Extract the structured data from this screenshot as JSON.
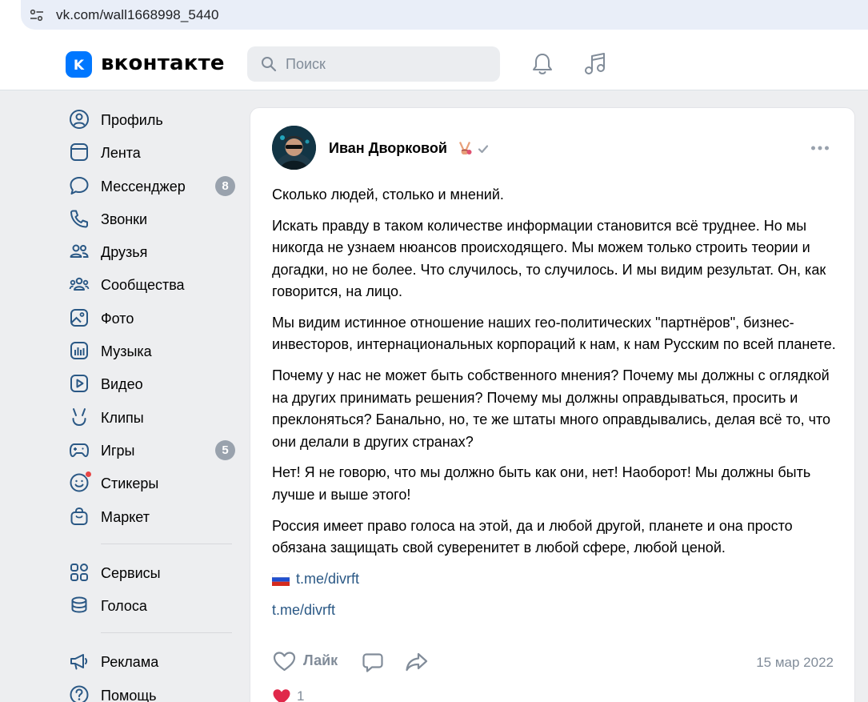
{
  "browser": {
    "url": "vk.com/wall1668998_5440"
  },
  "header": {
    "logo_text": "вконтакте",
    "search_placeholder": "Поиск"
  },
  "sidebar": {
    "items": [
      {
        "label": "Профиль",
        "icon": "user-circle-icon"
      },
      {
        "label": "Лента",
        "icon": "feed-icon"
      },
      {
        "label": "Мессенджер",
        "icon": "message-icon",
        "badge": "8"
      },
      {
        "label": "Звонки",
        "icon": "phone-icon"
      },
      {
        "label": "Друзья",
        "icon": "friends-icon"
      },
      {
        "label": "Сообщества",
        "icon": "communities-icon"
      },
      {
        "label": "Фото",
        "icon": "photo-icon"
      },
      {
        "label": "Музыка",
        "icon": "music-bars-icon"
      },
      {
        "label": "Видео",
        "icon": "video-icon"
      },
      {
        "label": "Клипы",
        "icon": "clips-icon"
      },
      {
        "label": "Игры",
        "icon": "gamepad-icon",
        "badge": "5"
      },
      {
        "label": "Стикеры",
        "icon": "smile-icon"
      },
      {
        "label": "Маркет",
        "icon": "bag-icon"
      }
    ],
    "group2": [
      {
        "label": "Сервисы",
        "icon": "services-icon"
      },
      {
        "label": "Голоса",
        "icon": "coins-icon"
      }
    ],
    "group3": [
      {
        "label": "Реклама",
        "icon": "megaphone-icon"
      },
      {
        "label": "Помощь",
        "icon": "help-icon"
      }
    ]
  },
  "post": {
    "author": "Иван Дворковой",
    "paragraphs": [
      "Сколько людей, столько и мнений.",
      "Искать правду в таком количестве информации становится всё труднее. Но мы никогда не узнаем нюансов происходящего. Мы можем только строить теории и догадки, но не более. Что случилось, то случилось. И мы видим результат. Он, как говорится, на лицо.",
      "Мы видим истинное отношение наших гео-политических \"партнёров\", бизнес-инвесторов, интернациональных корпораций к нам, к нам Русским по всей планете.",
      "Почему у нас не может быть собственного мнения? Почему мы должны с оглядкой на других принимать решения? Почему мы должны оправдываться, просить и преклоняться? Банально, но, те же штаты много оправдывались, делая всё то, что они делали в других странах?",
      "Нет! Я не говорю, что мы должно быть как они, нет! Наоборот! Мы должны быть лучше и выше этого!",
      "Россия имеет право голоса на этой, да и любой другой, планете и она просто обязана защищать свой суверенитет в любой сфере, любой ценой."
    ],
    "link1": "t.me/divrft",
    "link2": "t.me/divrft",
    "like_label": "Лайк",
    "date": "15 мар 2022",
    "reaction_count": "1"
  }
}
